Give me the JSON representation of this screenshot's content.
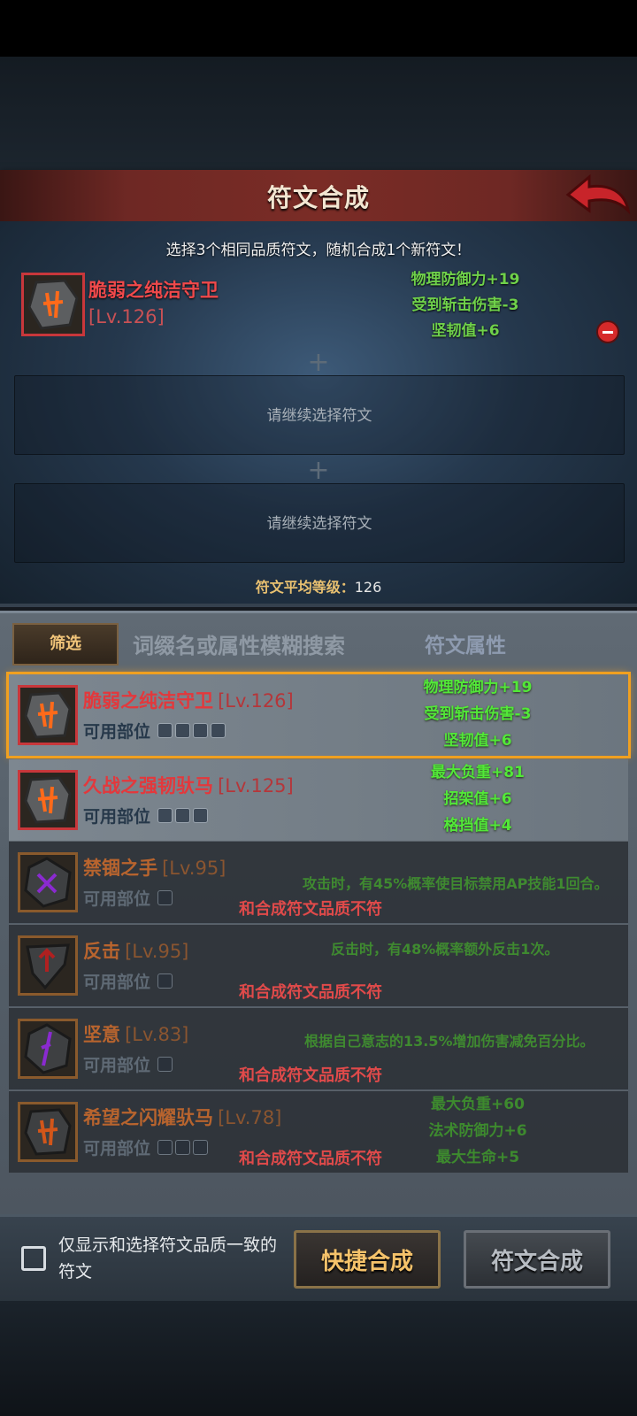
{
  "title": "符文合成",
  "instruction": "选择3个相同品质符文，随机合成1个新符文！",
  "selected_slot": {
    "name": "脆弱之纯洁守卫",
    "level": "[Lv.126]",
    "stats": [
      "物理防御力+19",
      "受到斩击伤害-3",
      "坚韧值+6"
    ]
  },
  "empty_slot_hint": "请继续选择符文",
  "plus_symbol": "+",
  "avg_level_label": "符文平均等级：",
  "avg_level_value": "126",
  "filter_label": "筛选",
  "search_placeholder": "词缀名或属性模糊搜索",
  "rune_attr_label": "符文属性",
  "parts_label": "可用部位",
  "mismatch_text": "和合成符文品质不符",
  "runes": [
    {
      "name": "脆弱之纯洁守卫",
      "level": "[Lv.126]",
      "quality": "red",
      "selected": true,
      "stats": [
        "物理防御力+19",
        "受到斩击伤害-3",
        "坚韧值+6"
      ],
      "parts": 4
    },
    {
      "name": "久战之强韧驮马",
      "level": "[Lv.125]",
      "quality": "red",
      "selected": false,
      "stats": [
        "最大负重+81",
        "招架值+6",
        "格挡值+4"
      ],
      "parts": 3
    },
    {
      "name": "禁锢之手",
      "level": "[Lv.95]",
      "quality": "brown",
      "disabled": true,
      "effect": "攻击时，有45%概率使目标禁用AP技能1回合。",
      "parts": 1
    },
    {
      "name": "反击",
      "level": "[Lv.95]",
      "quality": "brown",
      "disabled": true,
      "effect": "反击时，有48%概率额外反击1次。",
      "parts": 1
    },
    {
      "name": "坚意",
      "level": "[Lv.83]",
      "quality": "brown",
      "disabled": true,
      "effect": "根据自己意志的13.5%增加伤害减免百分比。",
      "parts": 1
    },
    {
      "name": "希望之闪耀驮马",
      "level": "[Lv.78]",
      "quality": "brown",
      "disabled": true,
      "stats": [
        "最大负重+60",
        "法术防御力+6",
        "最大生命+5"
      ],
      "parts": 3
    }
  ],
  "only_show_label": "仅显示和选择符文品质一致的符文",
  "quick_compose_label": "快捷合成",
  "compose_label": "符文合成",
  "colors": {
    "accent_gold": "#f5c26a",
    "stat_green": "#52e838",
    "quality_red": "#e3383c",
    "quality_brown": "#b8642e",
    "mismatch_red": "#e04a4a"
  }
}
